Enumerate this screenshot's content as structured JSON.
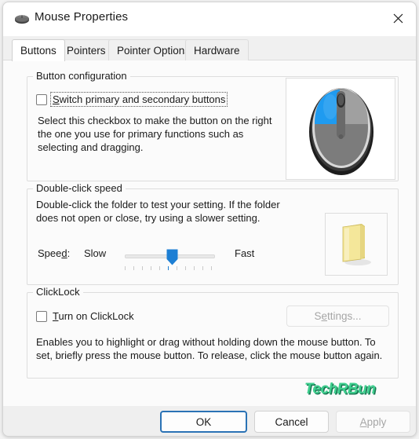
{
  "window": {
    "title": "Mouse Properties",
    "icon": "mouse-icon",
    "close_icon": "close-icon"
  },
  "tabs": [
    {
      "label": "Buttons",
      "active": true
    },
    {
      "label": "Pointers",
      "active": false
    },
    {
      "label": "Pointer Options",
      "active": false
    },
    {
      "label": "Hardware",
      "active": false
    }
  ],
  "button_configuration": {
    "group_title": "Button configuration",
    "checkbox": {
      "label_before": "S",
      "label_after": "witch primary and secondary buttons",
      "checked": false,
      "focused": true
    },
    "description": "Select this checkbox to make the button on the right the one you use for primary functions such as selecting and dragging.",
    "preview_icon": "mouse-preview-image"
  },
  "double_click_speed": {
    "group_title": "Double-click speed",
    "description": "Double-click the folder to test your setting. If the folder does not open or close, try using a slower setting.",
    "speed_label_before": "Spee",
    "speed_label_acc": "d",
    "speed_label_after": ":",
    "slow_label": "Slow",
    "fast_label": "Fast",
    "slider_value": 6,
    "slider_min": 1,
    "slider_max": 11,
    "tick_count": 11,
    "preview_icon": "folder-icon"
  },
  "clicklock": {
    "group_title": "ClickLock",
    "checkbox": {
      "label_before": "T",
      "label_after": "urn on ClickLock",
      "checked": false
    },
    "settings_button": {
      "label_before": "S",
      "label_acc": "e",
      "label_after": "ttings...",
      "disabled": true
    },
    "description": "Enables you to highlight or drag without holding down the mouse button. To set, briefly press the mouse button. To release, click the mouse button again."
  },
  "watermark": {
    "text": "TechRBun"
  },
  "footer": {
    "ok": "OK",
    "cancel": "Cancel",
    "apply_before": "A",
    "apply_after": "pply",
    "apply_disabled": true
  },
  "colors": {
    "accent": "#1d7fd4",
    "default_button_border": "#2a72b5",
    "watermark_green": "#3ecf8e",
    "folder_yellow": "#f2e08a"
  }
}
